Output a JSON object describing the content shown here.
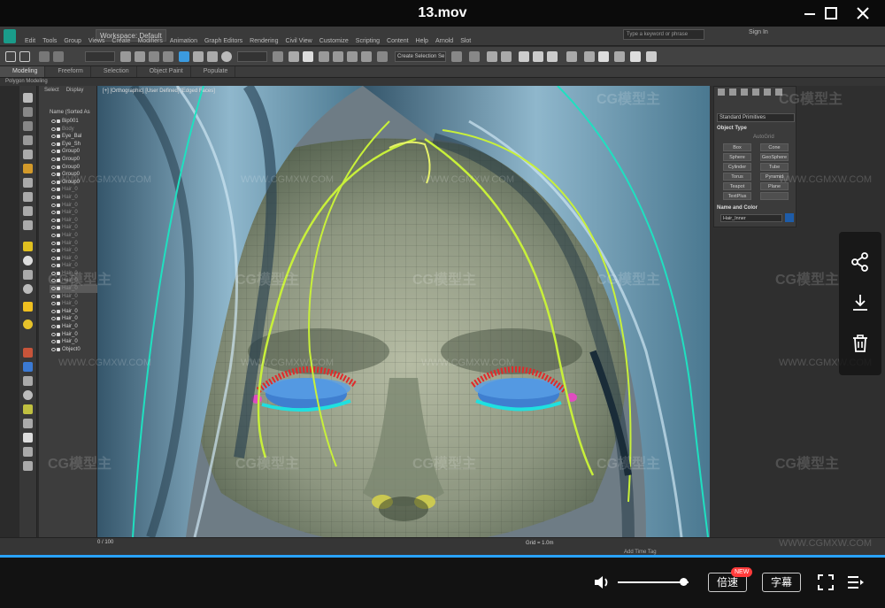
{
  "player": {
    "title": "13.mov",
    "window_buttons": [
      "minimize-icon",
      "maximize-icon",
      "close-icon"
    ],
    "speed_label": "倍速",
    "speed_badge": "NEW",
    "subtitle_label": "字幕",
    "volume_fraction": 0.92,
    "progress_color": "#29a3ff"
  },
  "watermarks": {
    "brand_text": "CG模型主",
    "url_text": "WWW.CGMXW.COM"
  },
  "max": {
    "workspace": "Workspace: Default",
    "menus": [
      "Edit",
      "Tools",
      "Group",
      "Views",
      "Create",
      "Modifiers",
      "Animation",
      "Graph Editors",
      "Rendering",
      "Civil View",
      "Customize",
      "Scripting",
      "Content",
      "Help",
      "Arnold",
      "Slot"
    ],
    "search_placeholder": "Type a keyword or phrase",
    "sign_in": "Sign In",
    "selection_set": "Create Selection Se",
    "ribbon_tabs": [
      "Modeling",
      "Freeform",
      "Selection",
      "Object Paint",
      "Populate"
    ],
    "ribbon_sub": "Polygon Modeling",
    "scene_tabs": [
      "Select",
      "Display"
    ],
    "scene_column": "Name (Sorted As",
    "scene_items": [
      {
        "name": "Bip001",
        "dim": false
      },
      {
        "name": "Body",
        "dim": true
      },
      {
        "name": "Eye_Bal",
        "dim": false
      },
      {
        "name": "Eye_Sh",
        "dim": false
      },
      {
        "name": "Group0",
        "dim": false
      },
      {
        "name": "Group0",
        "dim": false
      },
      {
        "name": "Group0",
        "dim": false
      },
      {
        "name": "Group0",
        "dim": false
      },
      {
        "name": "Group0",
        "dim": false
      },
      {
        "name": "Hair_0",
        "dim": true
      },
      {
        "name": "Hair_0",
        "dim": true
      },
      {
        "name": "Hair_0",
        "dim": true
      },
      {
        "name": "Hair_0",
        "dim": true
      },
      {
        "name": "Hair_0",
        "dim": true
      },
      {
        "name": "Hair_0",
        "dim": true
      },
      {
        "name": "Hair_0",
        "dim": true
      },
      {
        "name": "Hair_0",
        "dim": true
      },
      {
        "name": "Hair_0",
        "dim": true
      },
      {
        "name": "Hair_0",
        "dim": true
      },
      {
        "name": "Hair_0",
        "dim": true
      },
      {
        "name": "Hair_0",
        "dim": true
      },
      {
        "name": "Hair_0",
        "dim": true
      },
      {
        "name": "Hair_0",
        "dim": true
      },
      {
        "name": "Hair_0",
        "dim": true
      },
      {
        "name": "Hair_0",
        "dim": true
      },
      {
        "name": "Hair_0",
        "dim": false
      },
      {
        "name": "Hair_0",
        "dim": false
      },
      {
        "name": "Hair_0",
        "dim": false
      },
      {
        "name": "Hair_0",
        "dim": false
      },
      {
        "name": "Hair_0",
        "dim": false
      },
      {
        "name": "Object0",
        "dim": false
      }
    ],
    "viewport_label": "[+] [Orthographic] [User Defined] [Edged Faces]",
    "command_panel": {
      "category": "Standard Primitives",
      "object_type_title": "Object Type",
      "auto_grid": "AutoGrid",
      "buttons": [
        "Box",
        "Cone",
        "Sphere",
        "GeoSphere",
        "Cylinder",
        "Tube",
        "Torus",
        "Pyramid",
        "Teapot",
        "Plane",
        "TextPlus",
        ""
      ],
      "name_color_title": "Name and Color",
      "name_value": "Hair_Inner",
      "color": "#1e5ca8"
    },
    "frame_counter": "0 / 100",
    "grid": "Grid = 1.0m",
    "add_time_tag": "Add Time Tag"
  }
}
